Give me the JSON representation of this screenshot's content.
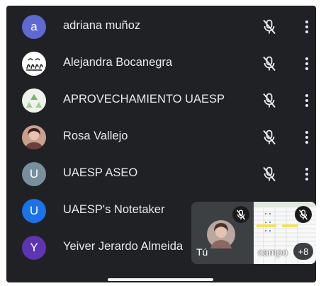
{
  "participants": [
    {
      "name": "adriana muñoz",
      "initial": "a",
      "avatar_color": "#5e6ad2"
    },
    {
      "name": "Alejandra Bocanegra",
      "initial": "",
      "avatar_color": "#ffffff"
    },
    {
      "name": "APROVECHAMIENTO UAESP",
      "initial": "",
      "avatar_color": "#e9f1e6"
    },
    {
      "name": "Rosa Vallejo",
      "initial": "",
      "avatar_color": "#b07a6a"
    },
    {
      "name": "UAESP ASEO",
      "initial": "U",
      "avatar_color": "#78909c"
    },
    {
      "name": "UAESP's Notetaker",
      "initial": "U",
      "avatar_color": "#1a73e8"
    },
    {
      "name": "Yeiver Jerardo Almeida",
      "initial": "Y",
      "avatar_color": "#5e35b1"
    }
  ],
  "self_tile": {
    "label": "Tú"
  },
  "share_tile": {
    "label": "campo",
    "count_badge": "+8"
  },
  "icons": {
    "mic": "mic-off-icon",
    "more": "more-vert-icon"
  },
  "colors": {
    "background": "#202124",
    "text": "#e8eaed",
    "icon": "#e8eaed"
  }
}
